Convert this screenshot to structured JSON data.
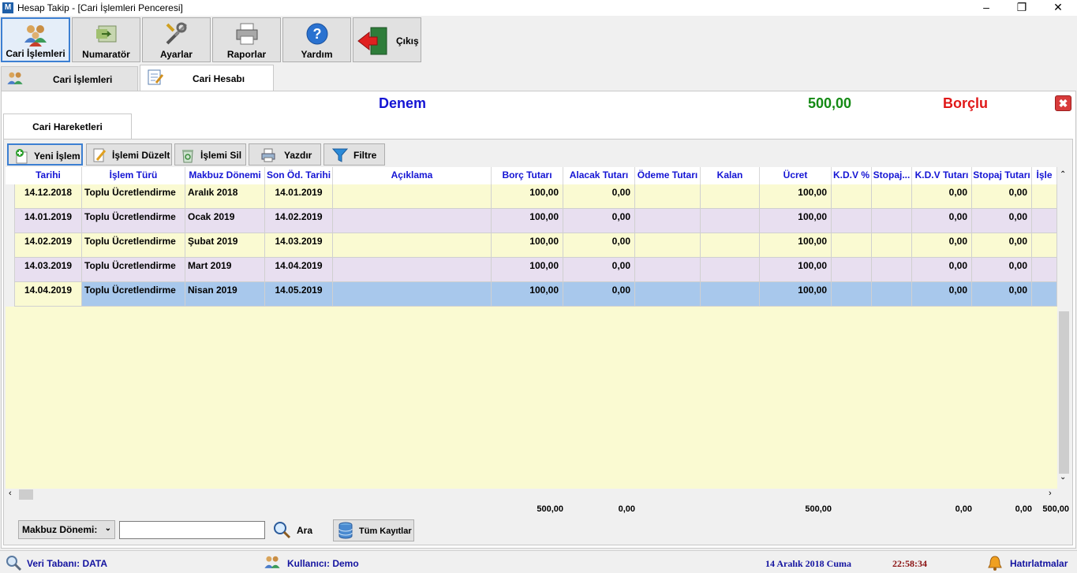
{
  "window": {
    "title": "Hesap Takip - [Cari İşlemleri Penceresi]",
    "app_icon": "M"
  },
  "toolbar": [
    {
      "label": "Cari İşlemleri",
      "icon": "users-icon"
    },
    {
      "label": "Numaratör",
      "icon": "numerator-icon"
    },
    {
      "label": "Ayarlar",
      "icon": "tools-icon"
    },
    {
      "label": "Raporlar",
      "icon": "printer-icon"
    },
    {
      "label": "Yardım",
      "icon": "help-icon"
    },
    {
      "label": "Çıkış",
      "icon": "exit-icon"
    }
  ],
  "tabs": [
    {
      "label": "Cari İşlemleri"
    },
    {
      "label": "Cari Hesabı"
    }
  ],
  "account": {
    "name": "Denem",
    "balance": "500,00",
    "status": "Borçlu"
  },
  "subtab": {
    "label": "Cari Hareketleri"
  },
  "actions": [
    {
      "label": "Yeni İşlem"
    },
    {
      "label": "İşlemi Düzelt"
    },
    {
      "label": "İşlemi Sil"
    },
    {
      "label": "Yazdır"
    },
    {
      "label": "Filtre"
    }
  ],
  "grid": {
    "columns": [
      "Tarihi",
      "İşlem Türü",
      "Makbuz Dönemi",
      "Son Öd. Tarihi",
      "Açıklama",
      "Borç Tutarı",
      "Alacak Tutarı",
      "Ödeme Tutarı",
      "Kalan",
      "Ücret",
      "K.D.V %",
      "Stopaj...",
      "K.D.V Tutarı",
      "Stopaj Tutarı",
      "İşle"
    ],
    "rows": [
      [
        "14.12.2018",
        "Toplu Ücretlendirme",
        "Aralık 2018",
        "14.01.2019",
        "",
        "100,00",
        "0,00",
        "",
        "",
        "100,00",
        "",
        "",
        "0,00",
        "0,00",
        ""
      ],
      [
        "14.01.2019",
        "Toplu Ücretlendirme",
        "Ocak 2019",
        "14.02.2019",
        "",
        "100,00",
        "0,00",
        "",
        "",
        "100,00",
        "",
        "",
        "0,00",
        "0,00",
        ""
      ],
      [
        "14.02.2019",
        "Toplu Ücretlendirme",
        "Şubat 2019",
        "14.03.2019",
        "",
        "100,00",
        "0,00",
        "",
        "",
        "100,00",
        "",
        "",
        "0,00",
        "0,00",
        ""
      ],
      [
        "14.03.2019",
        "Toplu Ücretlendirme",
        "Mart 2019",
        "14.04.2019",
        "",
        "100,00",
        "0,00",
        "",
        "",
        "100,00",
        "",
        "",
        "0,00",
        "0,00",
        ""
      ],
      [
        "14.04.2019",
        "Toplu Ücretlendirme",
        "Nisan 2019",
        "14.05.2019",
        "",
        "100,00",
        "0,00",
        "",
        "",
        "100,00",
        "",
        "",
        "0,00",
        "0,00",
        ""
      ]
    ],
    "totals": {
      "borc": "500,00",
      "alacak": "0,00",
      "ucret": "500,00",
      "kdv_tutari": "0,00",
      "stopaj_tutari": "0,00",
      "last": "500,00"
    }
  },
  "filter": {
    "field_label": "Makbuz Dönemi:",
    "search_value": "",
    "search_label": "Ara",
    "all_records": "Tüm Kayıtlar"
  },
  "statusbar": {
    "database": "Veri Tabanı: DATA",
    "user": "Kullanıcı: Demo",
    "date": "14 Aralık 2018 Cuma",
    "time": "22:58:34",
    "reminders": "Hatırlatmalar"
  }
}
